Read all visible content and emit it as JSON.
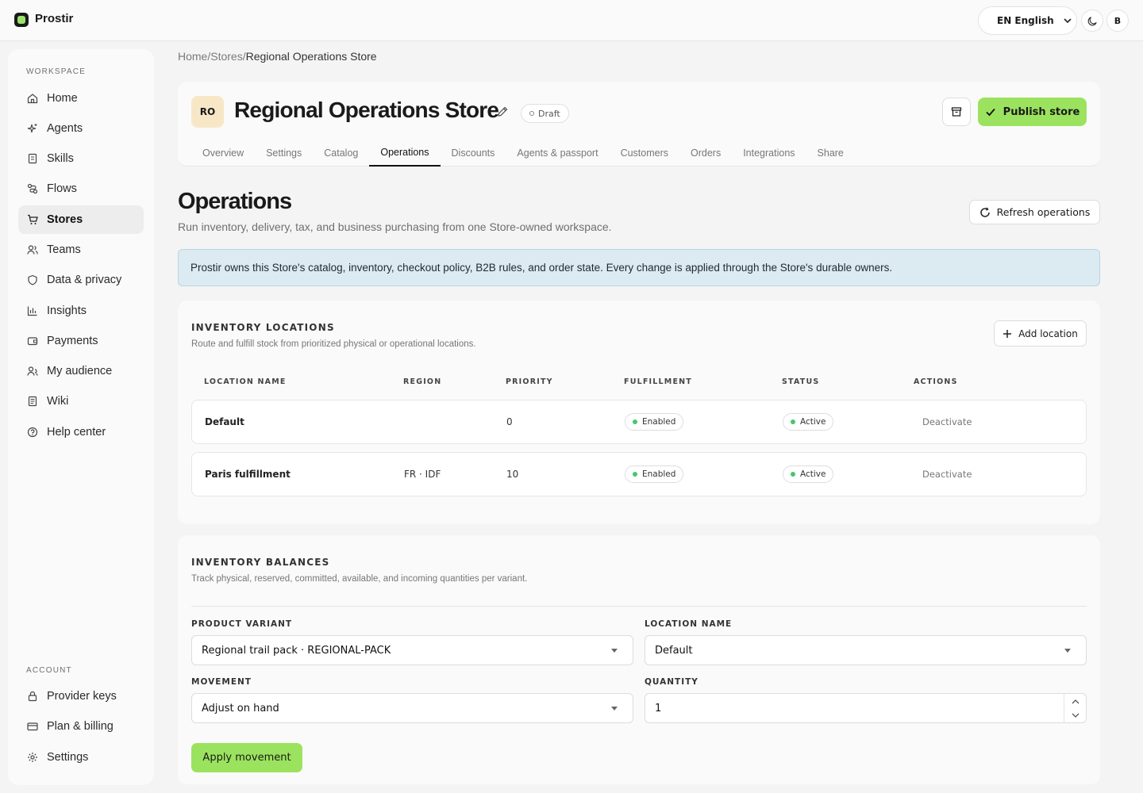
{
  "app": {
    "brand": "Prostir"
  },
  "topbar": {
    "language": "EN English",
    "user_initial": "B"
  },
  "sidebar": {
    "workspace_label": "WORKSPACE",
    "items": [
      {
        "label": "Home",
        "icon": "home-icon"
      },
      {
        "label": "Agents",
        "icon": "sparkles-icon"
      },
      {
        "label": "Skills",
        "icon": "book-icon"
      },
      {
        "label": "Flows",
        "icon": "flow-icon"
      },
      {
        "label": "Stores",
        "icon": "cart-icon",
        "active": true
      },
      {
        "label": "Teams",
        "icon": "users-icon"
      },
      {
        "label": "Data & privacy",
        "icon": "shield-icon"
      },
      {
        "label": "Insights",
        "icon": "chart-icon"
      },
      {
        "label": "Payments",
        "icon": "wallet-icon"
      },
      {
        "label": "My audience",
        "icon": "audience-icon"
      },
      {
        "label": "Wiki",
        "icon": "wiki-icon"
      },
      {
        "label": "Help center",
        "icon": "help-icon"
      }
    ],
    "account_label": "ACCOUNT",
    "account_items": [
      {
        "label": "Provider keys",
        "icon": "lock-icon"
      },
      {
        "label": "Plan & billing",
        "icon": "card-icon"
      },
      {
        "label": "Settings",
        "icon": "gear-icon"
      }
    ]
  },
  "breadcrumb": {
    "home": "Home",
    "sep": "/",
    "stores": "Stores",
    "current": "Regional Operations Store"
  },
  "store": {
    "initials": "RO",
    "name": "Regional Operations Store",
    "status": "Draft",
    "publish_label": "Publish store",
    "tabs": [
      "Overview",
      "Settings",
      "Catalog",
      "Operations",
      "Discounts",
      "Agents & passport",
      "Customers",
      "Orders",
      "Integrations",
      "Share"
    ],
    "active_tab": "Operations"
  },
  "page": {
    "title": "Operations",
    "subtitle": "Run inventory, delivery, tax, and business purchasing from one Store-owned workspace.",
    "refresh_label": "Refresh operations",
    "info_banner": "Prostir owns this Store's catalog, inventory, checkout policy, B2B rules, and order state. Every change is applied through the Store's durable owners."
  },
  "locations": {
    "title": "INVENTORY LOCATIONS",
    "description": "Route and fulfill stock from prioritized physical or operational locations.",
    "add_label": "Add location",
    "columns": [
      "LOCATION NAME",
      "REGION",
      "PRIORITY",
      "FULFILLMENT",
      "STATUS",
      "ACTIONS"
    ],
    "rows": [
      {
        "name": "Default",
        "region": "",
        "priority": "0",
        "fulfillment": "Enabled",
        "status": "Active",
        "action": "Deactivate"
      },
      {
        "name": "Paris fulfillment",
        "region": "FR · IDF",
        "priority": "10",
        "fulfillment": "Enabled",
        "status": "Active",
        "action": "Deactivate"
      }
    ]
  },
  "balances": {
    "title": "INVENTORY BALANCES",
    "description": "Track physical, reserved, committed, available, and incoming quantities per variant.",
    "variant_label": "PRODUCT VARIANT",
    "variant_value": "Regional trail pack · REGIONAL-PACK",
    "location_label": "LOCATION NAME",
    "location_value": "Default",
    "movement_label": "MOVEMENT",
    "movement_value": "Adjust on hand",
    "quantity_label": "QUANTITY",
    "quantity_value": "1",
    "apply_label": "Apply movement"
  },
  "colors": {
    "accent": "#9be35f",
    "info_bg": "#dceaf1",
    "status_dot": "#4cc46a"
  }
}
